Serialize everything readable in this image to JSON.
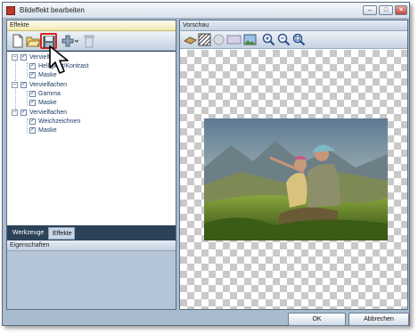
{
  "window": {
    "title": "Bildeffekt bearbeiten",
    "minimize": "–",
    "maximize": "□",
    "close": "×"
  },
  "left_panel": {
    "header": "Effekte",
    "toolbar_icons": [
      "new-file-icon",
      "open-folder-icon",
      "save-icon",
      "add-effect-icon",
      "delete-icon"
    ],
    "tree": [
      {
        "label": "Vervielfa",
        "level": 0,
        "checked": true
      },
      {
        "label": "Helligkeit/Kontrast",
        "level": 1,
        "checked": true
      },
      {
        "label": "Maske",
        "level": 1,
        "checked": true
      },
      {
        "label": "Vervielfachen",
        "level": 0,
        "checked": true
      },
      {
        "label": "Gamma",
        "level": 1,
        "checked": true
      },
      {
        "label": "Maske",
        "level": 1,
        "checked": true
      },
      {
        "label": "Vervielfachen",
        "level": 0,
        "checked": true
      },
      {
        "label": "Weichzeichnen",
        "level": 1,
        "checked": true
      },
      {
        "label": "Maske",
        "level": 1,
        "checked": true
      }
    ],
    "tabs": {
      "tools": "Werkzeuge",
      "effects": "Effekte"
    },
    "properties_header": "Eigenschaften"
  },
  "right_panel": {
    "header": "Vorschau",
    "toolbar_icons": [
      "brush-icon",
      "pattern-icon",
      "circle-mask-icon",
      "rect-mask-icon",
      "image-icon",
      "zoom-in-icon",
      "zoom-out-icon",
      "zoom-fit-icon"
    ]
  },
  "buttons": {
    "ok": "OK",
    "cancel": "Abbrechen"
  },
  "colors": {
    "accent_highlight": "#d9241c",
    "panel_dark": "#2c4259",
    "window_bg": "#a9bbcf"
  }
}
